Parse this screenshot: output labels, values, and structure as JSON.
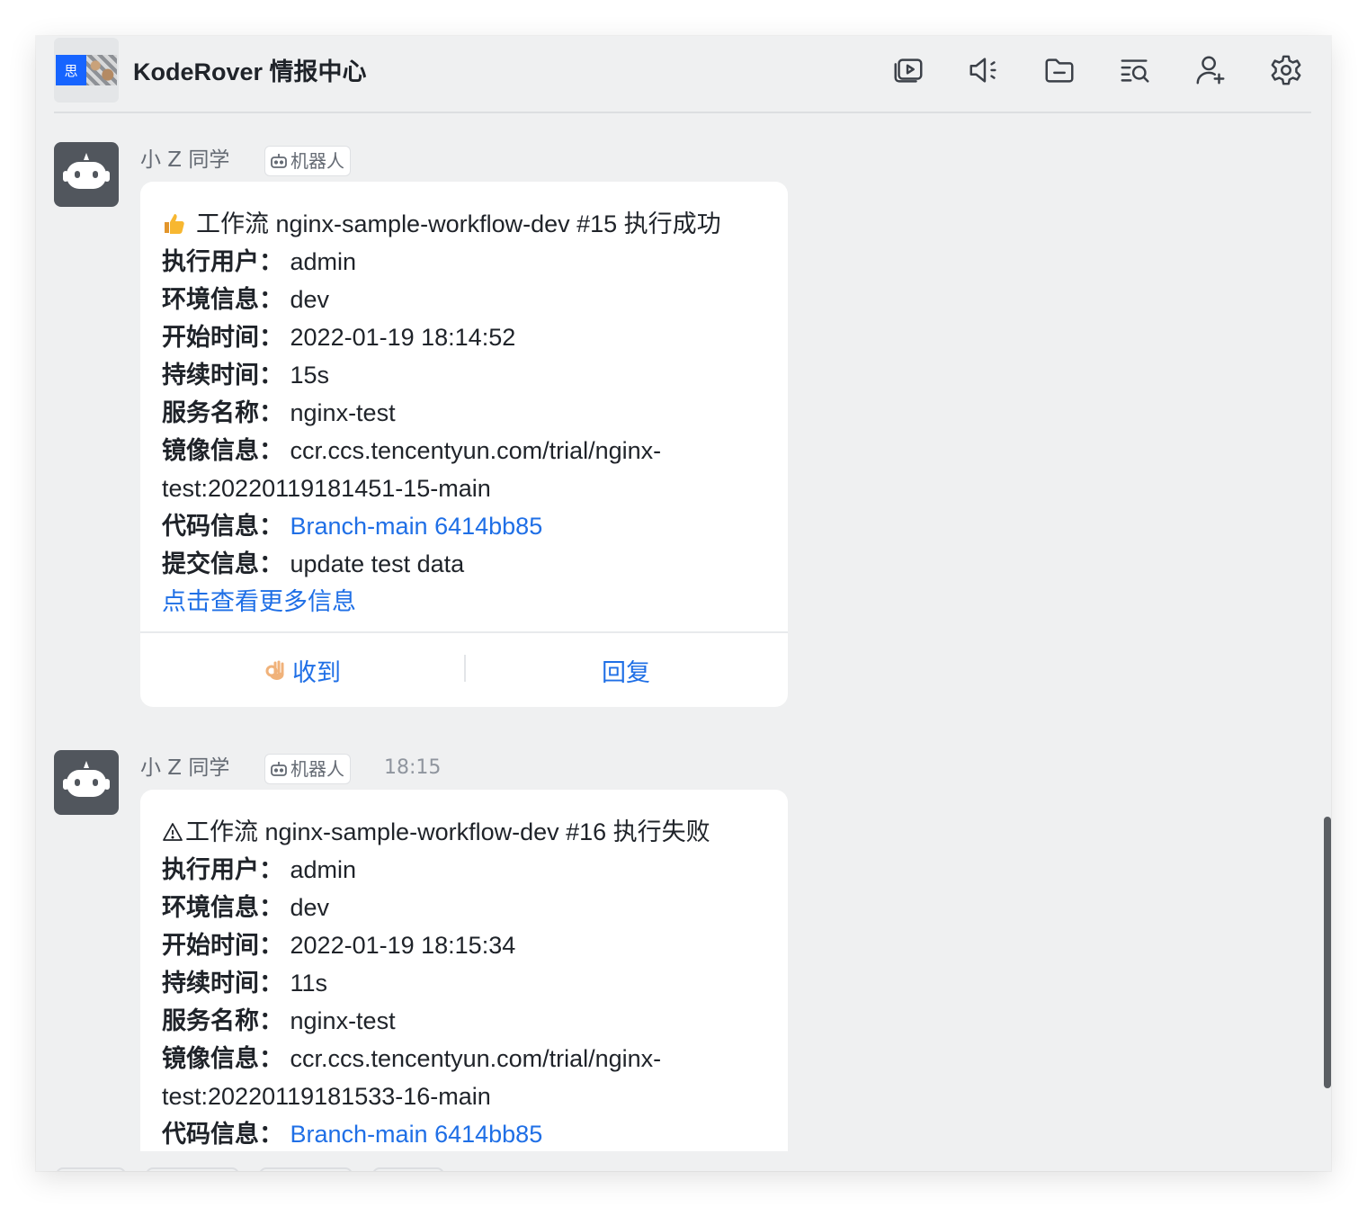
{
  "header": {
    "group_avatar_text": "思",
    "title": "KodeRover 情报中心",
    "icons": [
      "video-playlist-icon",
      "announcement-icon",
      "folder-icon",
      "search-history-icon",
      "add-member-icon",
      "settings-icon"
    ]
  },
  "messages": [
    {
      "sender": "小 Z 同学",
      "tag": "机器人",
      "time": "",
      "title": "工作流 nginx-sample-workflow-dev #15 执行成功",
      "fields": [
        {
          "key": "执行用户：",
          "value": "admin"
        },
        {
          "key": "环境信息：",
          "value": "dev"
        },
        {
          "key": "开始时间：",
          "value": "2022-01-19 18:14:52"
        },
        {
          "key": "持续时间：",
          "value": "15s"
        },
        {
          "key": "服务名称：",
          "value": "nginx-test"
        },
        {
          "key": "镜像信息：",
          "value": "ccr.ccs.tencentyun.com/trial/nginx-",
          "cont": "test:20220119181451-15-main"
        },
        {
          "key": "代码信息：",
          "value": "Branch-main 6414bb85"
        },
        {
          "key": "提交信息：",
          "value": "update test data"
        }
      ],
      "more_link": "点击查看更多信息",
      "actions": {
        "ack": "收到",
        "reply": "回复"
      }
    },
    {
      "sender": "小 Z 同学",
      "tag": "机器人",
      "time": "18:15",
      "title": "工作流 nginx-sample-workflow-dev #16 执行失败",
      "fields": [
        {
          "key": "执行用户：",
          "value": "admin"
        },
        {
          "key": "环境信息：",
          "value": "dev"
        },
        {
          "key": "开始时间：",
          "value": "2022-01-19 18:15:34"
        },
        {
          "key": "持续时间：",
          "value": "11s"
        },
        {
          "key": "服务名称：",
          "value": "nginx-test"
        },
        {
          "key": "镜像信息：",
          "value": "ccr.ccs.tencentyun.com/trial/nginx-",
          "cont": "test:20220119181533-16-main"
        },
        {
          "key": "代码信息：",
          "value": "Branch-main 6414bb85"
        }
      ]
    }
  ],
  "colors": {
    "link": "#1f6fe6",
    "window_bg": "#eff0f1",
    "avatar_bg": "#51565d"
  }
}
